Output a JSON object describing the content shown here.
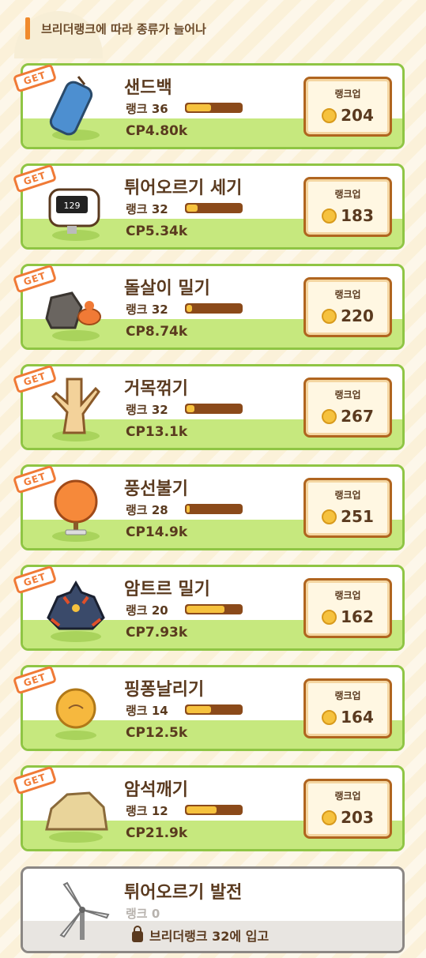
{
  "header": {
    "text": "브리더랭크에 따라 종류가 늘어나"
  },
  "rankup_label": "랭크업",
  "get_label": "GET",
  "items": [
    {
      "title": "샌드백",
      "rank": "랭크 36",
      "cp": "CP4.80k",
      "cost": "204",
      "progress": 0.45,
      "icon": "sandbag-icon"
    },
    {
      "title": "튀어오르기 세기",
      "rank": "랭크 32",
      "cp": "CP5.34k",
      "cost": "183",
      "progress": 0.2,
      "icon": "counter-machine-icon",
      "screen": "129"
    },
    {
      "title": "돌살이 밀기",
      "rank": "랭크 32",
      "cp": "CP8.74k",
      "cost": "220",
      "progress": 0.1,
      "icon": "dwebble-rock-icon"
    },
    {
      "title": "거목꺾기",
      "rank": "랭크 32",
      "cp": "CP13.1k",
      "cost": "267",
      "progress": 0.15,
      "icon": "tree-stump-icon"
    },
    {
      "title": "풍선불기",
      "rank": "랭크 28",
      "cp": "CP14.9k",
      "cost": "251",
      "progress": 0.05,
      "icon": "balloon-icon"
    },
    {
      "title": "암트르 밀기",
      "rank": "랭크 20",
      "cp": "CP7.93k",
      "cost": "162",
      "progress": 0.7,
      "icon": "boldore-icon"
    },
    {
      "title": "핑퐁날리기",
      "rank": "랭크 14",
      "cp": "CP12.5k",
      "cost": "164",
      "progress": 0.45,
      "icon": "pingpong-ball-icon"
    },
    {
      "title": "암석깨기",
      "rank": "랭크 12",
      "cp": "CP21.9k",
      "cost": "203",
      "progress": 0.55,
      "icon": "boulder-icon"
    }
  ],
  "locked": {
    "title": "튀어오르기 발전",
    "rank": "랭크 0",
    "requirement": "브리더랭크 32에 입고",
    "icon": "wind-turbine-icon"
  },
  "colors": {
    "card_border": "#8fc544",
    "get_tag": "#f07a36",
    "progress_fill": "#f6c23e",
    "progress_track": "#8b4a1a"
  }
}
